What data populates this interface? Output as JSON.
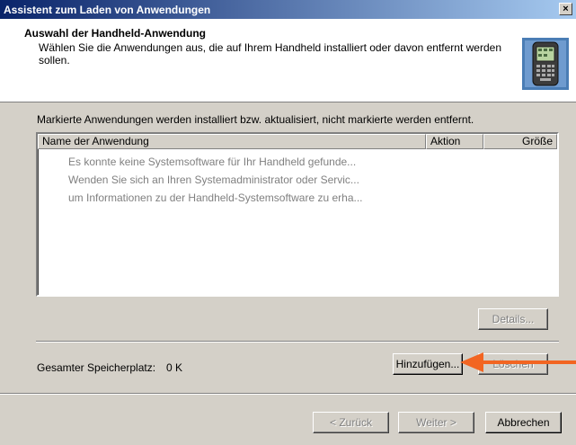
{
  "window": {
    "title": "Assistent zum Laden von Anwendungen",
    "close_label": "×"
  },
  "header": {
    "title": "Auswahl der Handheld-Anwendung",
    "subtitle": "Wählen Sie die Anwendungen aus, die auf Ihrem Handheld installiert oder davon entfernt werden sollen.",
    "image_icon": "handheld-device-icon"
  },
  "instruction": "Markierte Anwendungen werden installiert bzw. aktualisiert, nicht markierte werden entfernt.",
  "list": {
    "columns": [
      "Name der Anwendung",
      "Aktion",
      "Größe"
    ],
    "rows": [
      "Es konnte keine Systemsoftware für Ihr Handheld gefunde...",
      "Wenden Sie sich an Ihren Systemadministrator oder Servic...",
      "um Informationen zu der Handheld-Systemsoftware zu erha..."
    ]
  },
  "buttons": {
    "details": "Details...",
    "add": "Hinzufügen...",
    "delete": "Löschen",
    "back": "< Zurück",
    "next": "Weiter >",
    "cancel": "Abbrechen"
  },
  "storage": {
    "label": "Gesamter Speicherplatz:",
    "value": "0 K"
  },
  "annotation": {
    "arrow_color": "#f26522"
  }
}
